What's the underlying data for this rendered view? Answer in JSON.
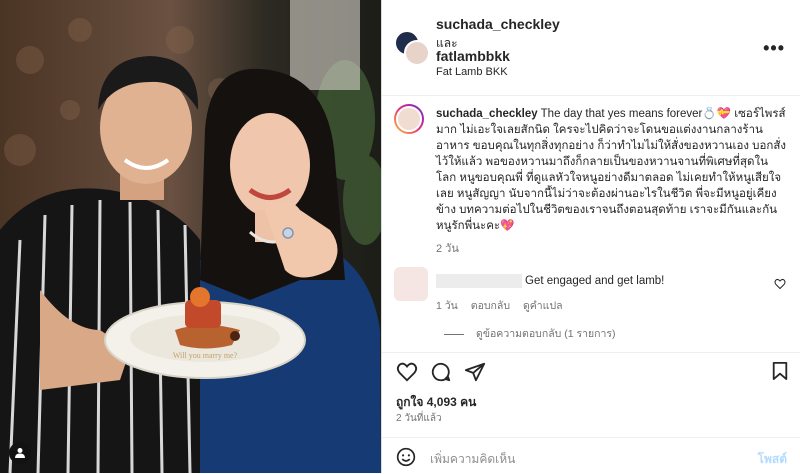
{
  "header": {
    "user1": "suchada_checkley",
    "and": "และ",
    "user2": "fatlambbkk",
    "location": "Fat Lamb BKK",
    "more_icon": "more-horizontal-icon"
  },
  "caption": {
    "username": "suchada_checkley",
    "text": " The day that yes means forever💍💝 เซอร์ไพรส์มาก ไม่เอะใจเลยสักนิด ใครจะไปคิดว่าจะโดนขอแต่งงานกลางร้านอาหาร ขอบคุณในทุกสิ่งทุกอย่าง ก็ว่าทำไมไม่ให้สั่งของหวานเอง บอกสั่งไว้ให้แล้ว พอของหวานมาถึงก็กลายเป็นของหวานจานที่พิเศษที่สุดในโลก หนูขอบคุณพี่ ที่ดูแลหัวใจหนูอย่างดีมาตลอด ไม่เคยทำให้หนูเสียใจเลย หนูสัญญา นับจากนี้ไม่ว่าจะต้องผ่านอะไรในชีวิต พี่จะมีหนูอยู่เคียงข้าง บทความต่อไปในชีวิตของเราจนถึงตอนสุดท้าย เราจะมีกันและกัน หนูรักพี่นะคะ💖",
    "ago": "2 วัน"
  },
  "comment": {
    "text": "Get engaged and get lamb!",
    "age": "1 วัน",
    "reply": "ตอบกลับ",
    "translate": "ดูคำแปล",
    "view_replies": "ดูข้อความตอบกลับ (1 รายการ)"
  },
  "actions": {
    "likes": "ถูกใจ 4,093 คน",
    "date": "2 วันที่แล้ว"
  },
  "comment_bar": {
    "placeholder": "เพิ่มความคิดเห็น",
    "post": "โพสต์"
  },
  "photo": {
    "plate_text": "Will you marry me?"
  }
}
